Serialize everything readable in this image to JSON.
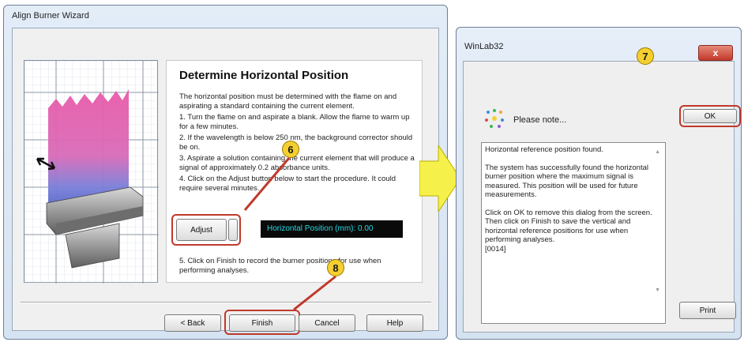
{
  "wizard": {
    "title": "Align Burner Wizard",
    "heading": "Determine Horizontal Position",
    "intro": "The horizontal position must be determined with the flame on and aspirating a standard containing the current element.",
    "steps": [
      "1. Turn the flame on and aspirate a blank.  Allow the flame to warm up for a few minutes.",
      "2. If the wavelength is below 250 nm, the background corrector should be on.",
      "3. Aspirate a solution containing the current element that will produce a signal of approximately 0.2 absorbance units.",
      "4. Click on the Adjust button below to start the procedure. It could require several minutes."
    ],
    "adjust_label": "Adjust",
    "readout": "Horizontal Position (mm):  0.00",
    "step5": "5. Click on Finish to record the burner positions for use when performing analyses.",
    "buttons": {
      "back": "< Back",
      "finish": "Finish",
      "cancel": "Cancel",
      "help": "Help"
    }
  },
  "callouts": {
    "six": "6",
    "seven": "7",
    "eight": "8"
  },
  "dialog": {
    "title": "WinLab32",
    "header": "Please note...",
    "ok_label": "OK",
    "print_label": "Print",
    "close_label": "x",
    "message": [
      "Horizontal reference position found.",
      "The system has successfully found the horizontal burner position where the maximum signal is measured. This position will be used for future measurements.",
      "Click on OK to remove this dialog from the screen. Then click on Finish to save the vertical and horizontal reference positions for use when performing analyses.",
      "[0014]"
    ]
  },
  "colors": {
    "callout": "#f4cf2f",
    "highlight": "#c0392b",
    "arrow": "#f6f04a",
    "readout_text": "#27d9e3"
  }
}
